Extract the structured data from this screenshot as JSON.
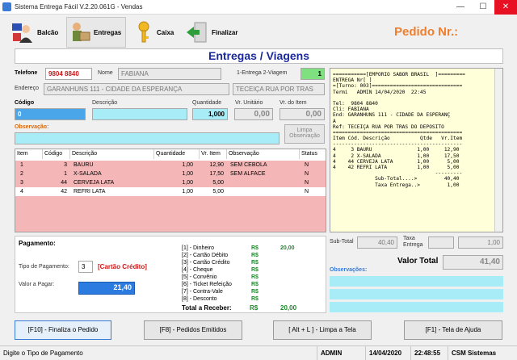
{
  "window": {
    "title": "Sistema Entrega Fácil V.2.20.061G - Vendas",
    "minimize": "—",
    "maximize": "☐",
    "close": "✕"
  },
  "toolbar": {
    "balcao": "Balcão",
    "entregas": "Entregas",
    "caixa": "Caixa",
    "finalizar": "Finalizar"
  },
  "pedido_nr_label": "Pedido Nr.:",
  "section_title": "Entregas / Viagens",
  "customer": {
    "telefone_label": "Telefone",
    "telefone": "9804 8840",
    "nome_label": "Nome",
    "nome": "FABIANA",
    "tipo_label": "1-Entrega 2-Viagem",
    "tipo": "1",
    "endereco_label": "Endereço",
    "endereco": "GARANHUNS 111 - CIDADE DA ESPERANÇA",
    "referencia": "TECEIÇA RUA POR TRAS"
  },
  "item_entry": {
    "codigo_label": "Código",
    "codigo": "0",
    "descricao_label": "Descrição",
    "descricao": "",
    "quantidade_label": "Quantidade",
    "quantidade": "1,000",
    "vr_unitario_label": "Vr. Unitário",
    "vr_unitario": "0,00",
    "vr_item_label": "Vr. do Item",
    "vr_item": "0,00",
    "observacao_label": "Observação:",
    "limpa_obs_line1": "Limpa",
    "limpa_obs_line2": "Observação"
  },
  "table": {
    "headers": [
      "Item",
      "Código",
      "Descrição",
      "Quantidade",
      "Vr. Item",
      "Observação",
      "Status"
    ],
    "rows": [
      {
        "item": "1",
        "codigo": "3",
        "descricao": "BAURU",
        "quantidade": "1,00",
        "vr_item": "12,90",
        "obs": "SEM CEBOLA",
        "status": "N"
      },
      {
        "item": "2",
        "codigo": "1",
        "descricao": "X-SALADA",
        "quantidade": "1,00",
        "vr_item": "17,50",
        "obs": "SEM ALFACE",
        "status": "N"
      },
      {
        "item": "3",
        "codigo": "44",
        "descricao": "CERVEJA LATA",
        "quantidade": "1,00",
        "vr_item": "5,00",
        "obs": "",
        "status": "N"
      },
      {
        "item": "4",
        "codigo": "42",
        "descricao": "REFRI LATA",
        "quantidade": "1,00",
        "vr_item": "5,00",
        "obs": "",
        "status": "N"
      }
    ]
  },
  "receipt": {
    "lines": [
      "===========[EMPORIO SABOR BRASIL  ]=========",
      "ENTREGA Nr[ ]",
      "=[Turno: 003]==============================",
      "Termi   ADMIN 14/04/2020  22:45",
      "",
      "Tel:  9804 8840",
      "Cli: FABIANA",
      "End: GARANHUNS 111 - CIDADE DA ESPERANÇ",
      "A",
      "Ref: TECEIÇA RUA POR TRAS DO DEPOSITO",
      "===========================================",
      "Item Cód. Descrição          Qtde   Vr.Item",
      "-------------------------------------------",
      "4     3 BAURU               1,00     12,90",
      "4     2 X-SALADA            1,00     17,50",
      "4    44 CERVEJA LATA        1,00      5,00",
      "4    42 REFRI LATA          1,00      5,00",
      "                                  ---------",
      "              Sub-Total....>         40,40",
      "              Taxa Entrega..>         1,00"
    ]
  },
  "payment": {
    "title": "Pagamento:",
    "tipo_label": "Tipo de Pagamento:",
    "tipo": "3",
    "tipo_desc": "[Cartão Crédito]",
    "valor_label": "Valor a Pagar:",
    "valor": "21,40",
    "currency": "R$",
    "methods": [
      {
        "label": "[1] - Dinheiro",
        "value": "20,00"
      },
      {
        "label": "[2] - Cartão Débito",
        "value": ""
      },
      {
        "label": "[3] - Cartão Crédito",
        "value": ""
      },
      {
        "label": "[4] - Cheque",
        "value": ""
      },
      {
        "label": "[5] - Convênio",
        "value": ""
      },
      {
        "label": "[6] - Ticket Refeição",
        "value": ""
      },
      {
        "label": "[7] - Contra-Vale",
        "value": ""
      },
      {
        "label": "[8] - Desconto",
        "value": ""
      }
    ],
    "total_label": "Total a Receber:",
    "total": "20,00"
  },
  "totals": {
    "subtotal_label": "Sub-Total",
    "subtotal": "40,40",
    "taxa_label_1": "Taxa",
    "taxa_label_2": "Entrega",
    "taxa": "1,00",
    "valor_total_label": "Valor Total",
    "valor_total": "41,40",
    "observacoes_label": "Observações:"
  },
  "buttons": {
    "finaliza": "[F10] - Finaliza o Pedido",
    "pedidos": "[F8] - Pedidos Emitidos",
    "limpa": "[ Alt + L ] - Limpa a Tela",
    "ajuda": "[F1] - Tela de Ajuda"
  },
  "statusbar": {
    "message": "Digite o Tipo de Pagamento",
    "user": "ADMIN",
    "date": "14/04/2020",
    "time": "22:48:55",
    "company": "CSM Sistemas"
  }
}
